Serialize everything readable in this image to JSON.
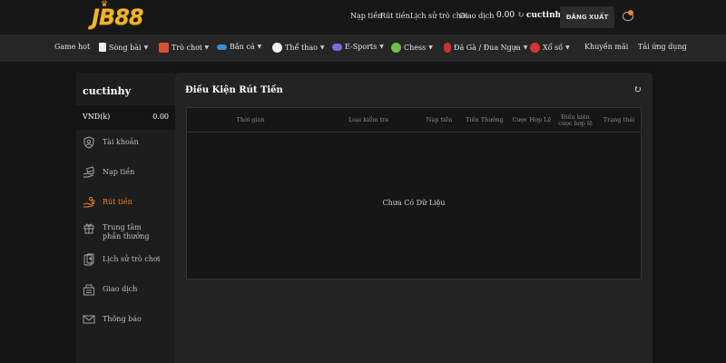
{
  "header": {
    "logo": "JB88",
    "links": [
      "Nạp tiền",
      "Rút tiền",
      "Lịch sử trò chơi",
      "Giao dịch"
    ],
    "balance": "0.00",
    "username": "cuctinhy",
    "logout_label": "ĐĂNG XUẤT"
  },
  "nav": {
    "items": [
      {
        "label": "Game hot",
        "icon": "",
        "dropdown": false
      },
      {
        "label": "Sòng bài",
        "icon": "cards-icon",
        "dropdown": true
      },
      {
        "label": "Trò chơi",
        "icon": "slot-machine-icon",
        "dropdown": true
      },
      {
        "label": "Bắn cá",
        "icon": "fish-icon",
        "dropdown": true
      },
      {
        "label": "Thể thao",
        "icon": "soccer-ball-icon",
        "dropdown": true
      },
      {
        "label": "E-Sports",
        "icon": "gamepad-icon",
        "dropdown": true
      },
      {
        "label": "Chess",
        "icon": "chess-icon",
        "dropdown": true
      },
      {
        "label": "Đá Gà / Đua Ngựa",
        "icon": "rooster-icon",
        "dropdown": true
      },
      {
        "label": "Xổ số",
        "icon": "lottery-ball-icon",
        "dropdown": true
      },
      {
        "label": "Khuyến mãi",
        "icon": "",
        "dropdown": false
      },
      {
        "label": "Tải ứng dụng",
        "icon": "",
        "dropdown": false
      }
    ]
  },
  "sidebar": {
    "username": "cuctinhy",
    "currency": "VND(k)",
    "amount": "0.00",
    "items": [
      {
        "label": "Tài khoản",
        "icon": "shield-user-icon",
        "active": false
      },
      {
        "label": "Nạp tiền",
        "icon": "deposit-hand-icon",
        "active": false
      },
      {
        "label": "Rút tiền",
        "icon": "withdraw-coins-icon",
        "active": true
      },
      {
        "label": "Trung tâm phần thưởng",
        "icon": "gift-icon",
        "active": false
      },
      {
        "label": "Lịch sử trò chơi",
        "icon": "game-history-icon",
        "active": false
      },
      {
        "label": "Giao dịch",
        "icon": "transaction-icon",
        "active": false
      },
      {
        "label": "Thông báo",
        "icon": "mail-icon",
        "active": false
      }
    ]
  },
  "main": {
    "title": "Điều Kiện Rút Tiền",
    "columns": [
      "Thời gian",
      "Loại kiểm tra",
      "Nạp tiền",
      "Tiền Thưởng",
      "Cược Hợp Lệ",
      "Điều kiện cược hợp lệ",
      "Trạng thái"
    ],
    "empty_text": "Chưa Có Dữ Liệu"
  },
  "colors": {
    "accent": "#e8862a",
    "brand": "#f0b429",
    "background": "#141414",
    "panel": "#232323"
  }
}
